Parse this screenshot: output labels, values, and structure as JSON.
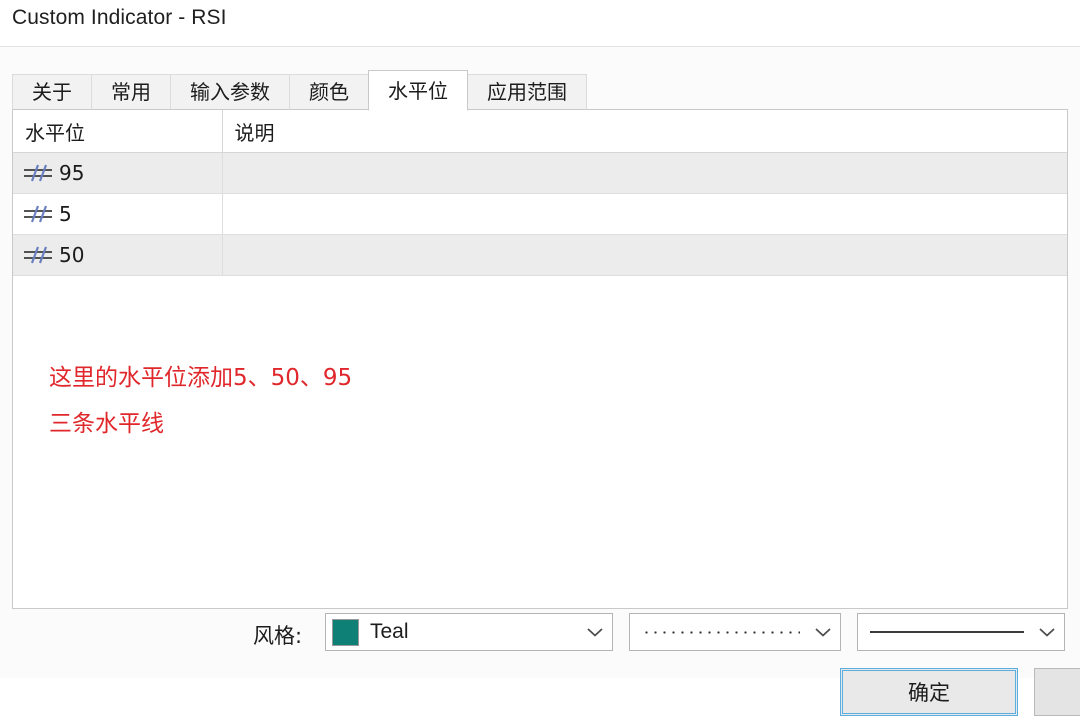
{
  "window": {
    "title": "Custom Indicator - RSI"
  },
  "tabs": [
    {
      "label": "关于",
      "active": false
    },
    {
      "label": "常用",
      "active": false
    },
    {
      "label": "输入参数",
      "active": false
    },
    {
      "label": "颜色",
      "active": false
    },
    {
      "label": "水平位",
      "active": true
    },
    {
      "label": "应用范围",
      "active": false
    }
  ],
  "table": {
    "columns": [
      "水平位",
      "说明"
    ],
    "rows": [
      {
        "icon": "horizontal-level-icon",
        "level": "95",
        "description": ""
      },
      {
        "icon": "horizontal-level-icon",
        "level": "5",
        "description": ""
      },
      {
        "icon": "horizontal-level-icon",
        "level": "50",
        "description": ""
      }
    ]
  },
  "annotation": {
    "line1": "这里的水平位添加5、50、95",
    "line2": "三条水平线",
    "color": "#e0272b"
  },
  "style_row": {
    "label": "风格:",
    "color_combo": {
      "value": "Teal",
      "swatch_color": "#0f8075",
      "chevron": "chevron-down-icon"
    },
    "line_style_combo": {
      "value": "dotted",
      "chevron": "chevron-down-icon"
    },
    "line_width_combo": {
      "value": "solid",
      "chevron": "chevron-down-icon"
    }
  },
  "buttons": {
    "ok": "确定",
    "cancel": ""
  }
}
